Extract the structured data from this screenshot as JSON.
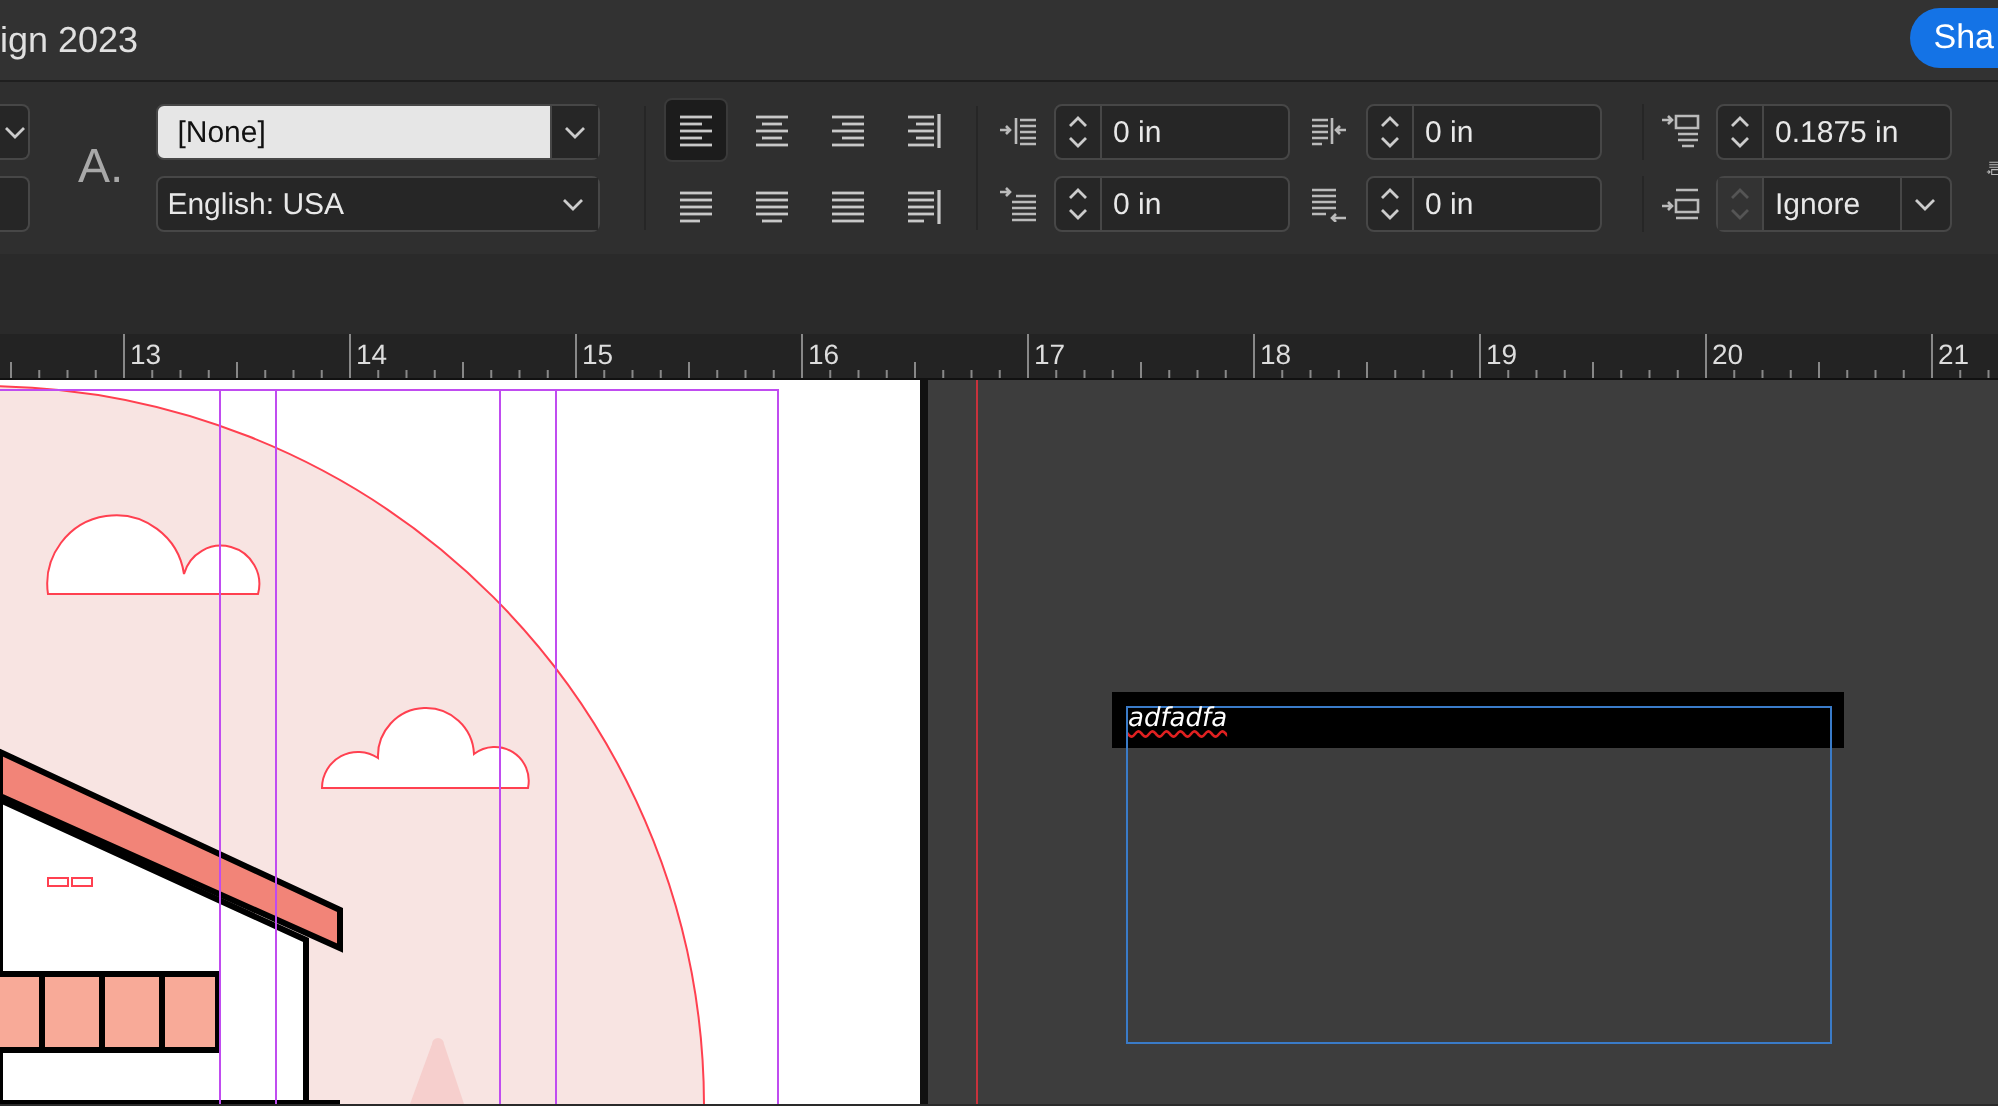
{
  "window": {
    "title": "ign 2023"
  },
  "share_button": {
    "label": "Sha"
  },
  "control_panel": {
    "style_glyph": "A.",
    "paragraph_style": {
      "value": "[None]"
    },
    "language": {
      "value": "English: USA"
    },
    "alignment_buttons": [
      {
        "kind": "left",
        "selected": true
      },
      {
        "kind": "center",
        "selected": false
      },
      {
        "kind": "right",
        "selected": false
      },
      {
        "kind": "spine",
        "selected": false
      },
      {
        "kind": "justify-left",
        "selected": false
      },
      {
        "kind": "justify-center",
        "selected": false
      },
      {
        "kind": "justify-all",
        "selected": false
      },
      {
        "kind": "away-spine",
        "selected": false
      }
    ],
    "fields": [
      {
        "kind": "number",
        "value": "0 in",
        "stepper_disabled": false
      },
      {
        "kind": "number",
        "value": "0 in",
        "stepper_disabled": false
      },
      {
        "kind": "number",
        "value": "0.1875 in",
        "stepper_disabled": false
      },
      {
        "kind": "number",
        "value": "0 in",
        "stepper_disabled": false
      },
      {
        "kind": "number",
        "value": "0 in",
        "stepper_disabled": false
      },
      {
        "kind": "dropdown",
        "value": "Ignore",
        "stepper_disabled": true
      }
    ]
  },
  "ruler": {
    "labels": [
      "13",
      "14",
      "15",
      "16",
      "17",
      "18",
      "19",
      "20",
      "21"
    ]
  },
  "text_frame": {
    "text": "adfadfa",
    "misspelled": true
  }
}
